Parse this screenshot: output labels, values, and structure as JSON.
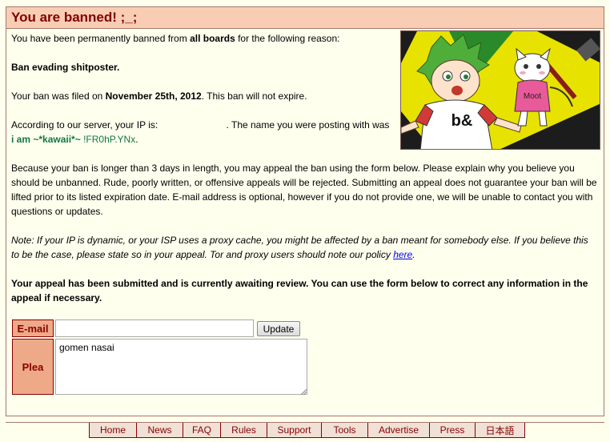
{
  "header": {
    "title": "You are banned! ;_;"
  },
  "ban": {
    "reason_prefix": "You have been permanently banned from ",
    "reason_boards": "all boards",
    "reason_suffix": " for the following reason:",
    "reason_text": "Ban evading shitposter.",
    "filed_prefix": "Your ban was filed on ",
    "filed_date": "November 25th, 2012",
    "filed_suffix": ". This ban will not expire.",
    "ip_prefix": "According to our server, your IP is: ",
    "ip_suffix": ". The name you were posting with was",
    "poster_name": "i am ~*kawaii*~",
    "poster_trip": "!FR0hP.YNx",
    "poster_end": ".",
    "appeal_text": "Because your ban is longer than 3 days in length, you may appeal the ban using the form below. Please explain why you believe you should be unbanned. Rude, poorly written, or offensive appeals will be rejected. Submitting an appeal does not guarantee your ban will be lifted prior to its listed expiration date. E-mail address is optional, however if you do not provide one, we will be unable to contact you with questions or updates.",
    "note_text": "Note: If your IP is dynamic, or your ISP uses a proxy cache, you might be affected by a ban meant for somebody else. If you believe this to be the case, please state so in your appeal. Tor and proxy users should note our policy ",
    "note_link": "here",
    "note_end": ".",
    "submitted_text": "Your appeal has been submitted and is currently awaiting review. You can use the form below to correct any information in the appeal if necessary."
  },
  "image": {
    "shirt_text": "b&",
    "cat_shirt_text": "Moot"
  },
  "form": {
    "email_label": "E-mail",
    "email_value": "",
    "update_label": "Update",
    "plea_label": "Plea",
    "plea_value": "gomen nasai"
  },
  "footer": {
    "links": [
      "Home",
      "News",
      "FAQ",
      "Rules",
      "Support",
      "Tools",
      "Advertise",
      "Press",
      "日本語"
    ]
  },
  "colors": {
    "header_bg": "#f8cdb3",
    "title": "#800000",
    "name_green": "#117743",
    "label_bg": "#eeaa88"
  }
}
